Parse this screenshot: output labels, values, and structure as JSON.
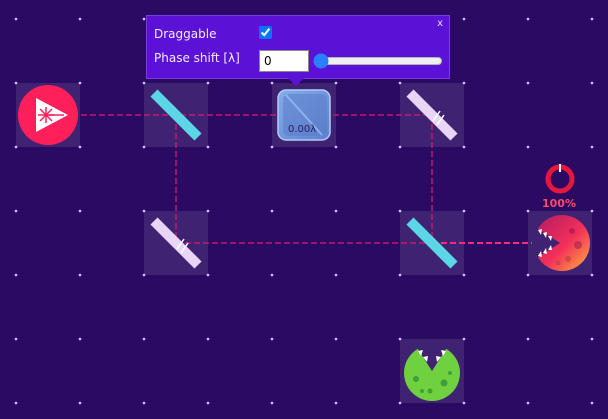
{
  "popup": {
    "close_label": "x",
    "draggable_label": "Draggable",
    "draggable_checked": true,
    "phase_label": "Phase shift [λ]",
    "phase_value": "0",
    "slider_value": 0
  },
  "phase_plate": {
    "label": "0.00λ"
  },
  "detector": {
    "percent": "100%",
    "level": 1.0
  },
  "colors": {
    "background": "#2b0a63",
    "popup": "#5b11d6",
    "beam": "#c21a6a",
    "beamsplitter": "#5ad6e6",
    "mirror": "#e8d6f6",
    "laser": "#ff1f5a",
    "detector_red": "#e8163a",
    "mine_green": "#6fd040"
  },
  "icons": {
    "laser": "laser-source-icon",
    "beamsplitter": "beamsplitter-icon",
    "mirror": "mirror-icon",
    "phase_plate": "phase-plate-icon",
    "detector": "detector-pacman-icon",
    "mine": "mine-pacman-icon",
    "gauge": "ring-gauge-icon"
  }
}
